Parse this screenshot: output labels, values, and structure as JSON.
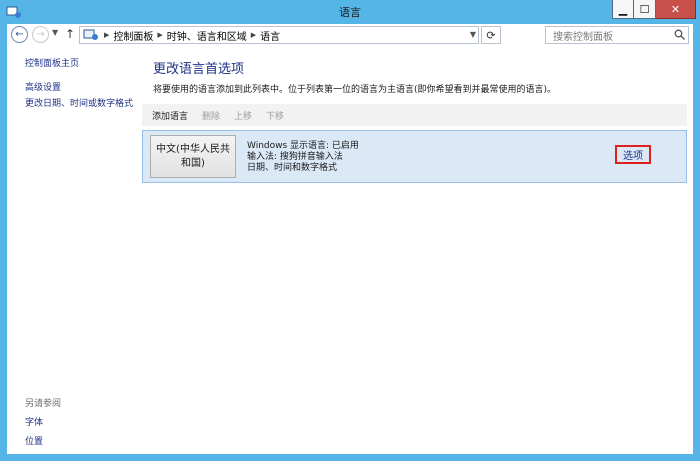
{
  "window": {
    "title": "语言",
    "controls": {
      "minimize": "▁",
      "maximize": "☐",
      "close": "✕"
    }
  },
  "address_bar": {
    "back_icon": "←",
    "forward_icon": "→",
    "up_icon": "↑",
    "crumbs": [
      "控制面板",
      "时钟、语言和区域",
      "语言"
    ],
    "refresh_icon": "⟳",
    "search_placeholder": "搜索控制面板"
  },
  "sidebar": {
    "home": "控制面板主页",
    "items": [
      "高级设置",
      "更改日期、时间或数字格式"
    ]
  },
  "see_also": {
    "header": "另请参阅",
    "items": [
      "字体",
      "位置"
    ]
  },
  "main": {
    "heading": "更改语言首选项",
    "description": "将要使用的语言添加到此列表中。位于列表第一位的语言为主语言(即你希望看到并最常使用的语言)。",
    "toolbar": {
      "add": "添加语言",
      "remove": "删除",
      "up": "上移",
      "down": "下移"
    },
    "language": {
      "name": "中文(中华人民共和国)",
      "info": [
        "Windows 显示语言: 已启用",
        "输入法: 搜狗拼音输入法",
        "日期、时间和数字格式"
      ],
      "options": "选项"
    }
  },
  "colors": {
    "titlebar": "#55b5e7",
    "link": "#1e3287",
    "selected_row": "#dbe9f7",
    "highlight": "#e02020"
  }
}
